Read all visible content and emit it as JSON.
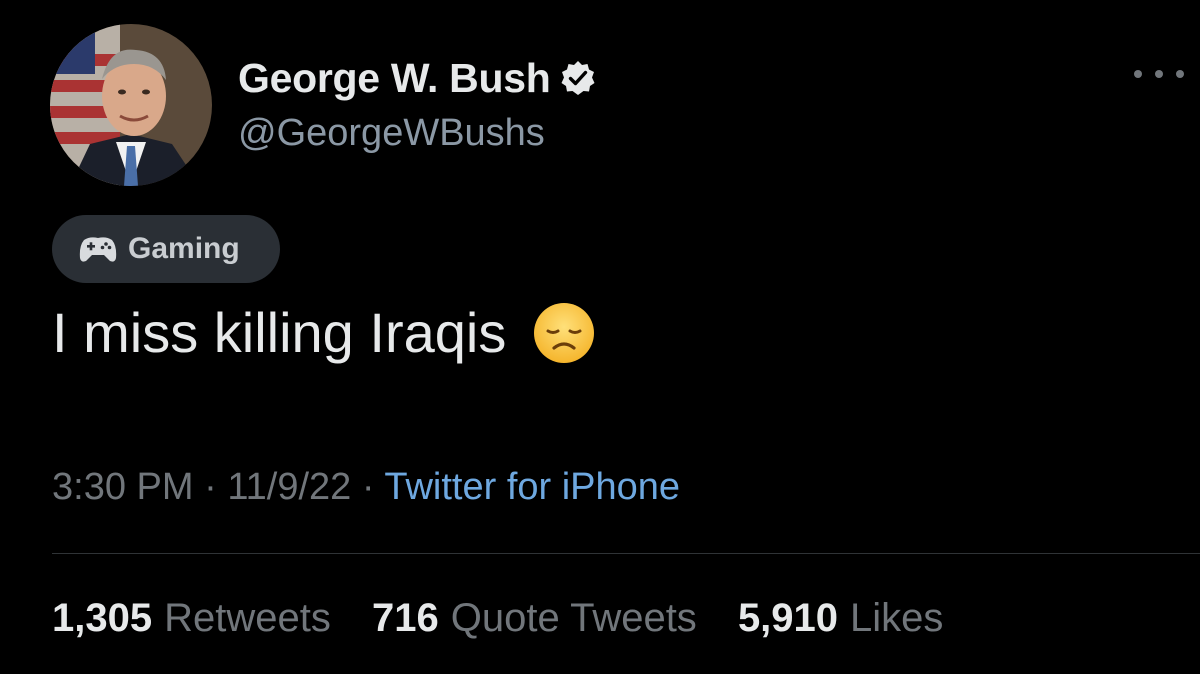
{
  "author": {
    "display_name": "George W. Bush",
    "handle": "@GeorgeWBushs",
    "verified_icon": "verified-badge-icon",
    "avatar_icon": "avatar-portrait"
  },
  "more_icon": "more-options-icon",
  "topic_tag": {
    "icon": "game-controller-icon",
    "label": "Gaming"
  },
  "tweet": {
    "text": "I miss killing Iraqis",
    "emoji": "disappointed-face-icon"
  },
  "meta": {
    "time": "3:30 PM",
    "separator": "·",
    "date": "11/9/22",
    "source": "Twitter for iPhone"
  },
  "stats": {
    "retweets_count": "1,305",
    "retweets_label": "Retweets",
    "quotes_count": "716",
    "quotes_label": "Quote Tweets",
    "likes_count": "5,910",
    "likes_label": "Likes"
  },
  "colors": {
    "background": "#000000",
    "primary_text": "#e7e9ea",
    "secondary_text": "#71767b",
    "link": "#6ea8e0",
    "tag_background": "#2a2f35"
  }
}
